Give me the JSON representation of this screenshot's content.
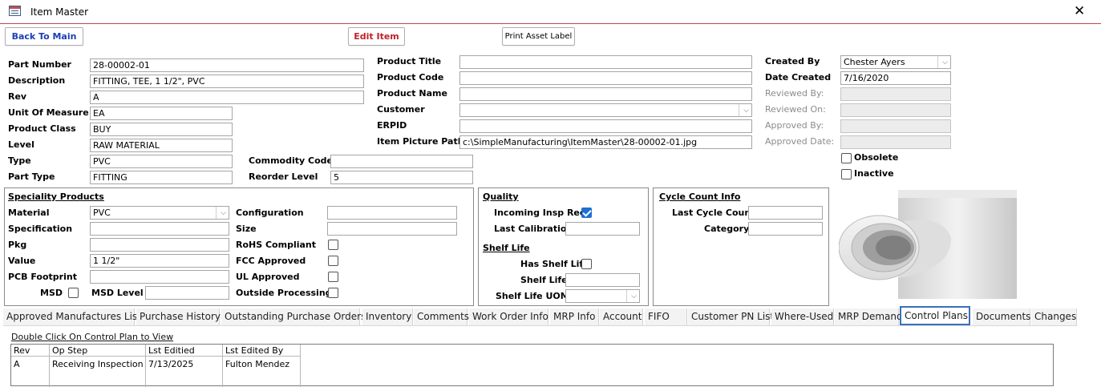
{
  "window": {
    "title": "Item Master",
    "close": "✕"
  },
  "buttons": {
    "back": "Back To Main",
    "edit": "Edit Item",
    "print": "Print Asset Label"
  },
  "item": {
    "part_number_label": "Part Number",
    "part_number": "28-00002-01",
    "description_label": "Description",
    "description": "FITTING, TEE, 1 1/2\", PVC",
    "rev_label": "Rev",
    "rev": "A",
    "uom_label": "Unit Of Measure",
    "uom": "EA",
    "product_class_label": "Product Class",
    "product_class": "BUY",
    "level_label": "Level",
    "level": "RAW MATERIAL",
    "type_label": "Type",
    "type": "PVC",
    "part_type_label": "Part Type",
    "part_type": "FITTING",
    "commodity_code_label": "Commodity Code",
    "commodity_code": "",
    "reorder_level_label": "Reorder Level",
    "reorder_level": "5"
  },
  "product": {
    "title_label": "Product Title",
    "title": "",
    "code_label": "Product Code",
    "code": "",
    "name_label": "Product Name",
    "name": "",
    "customer_label": "Customer",
    "customer": "",
    "erpid_label": "ERPID",
    "erpid": "",
    "picture_path_label": "Item Picture Path",
    "picture_path": "c:\\SimpleManufacturing\\ItemMaster\\28-00002-01.jpg"
  },
  "audit": {
    "created_by_label": "Created By",
    "created_by": "Chester Ayers",
    "date_created_label": "Date Created",
    "date_created": "7/16/2020",
    "reviewed_by_label": "Reviewed By:",
    "reviewed_on_label": "Reviewed On:",
    "approved_by_label": "Approved By:",
    "approved_date_label": "Approved Date:",
    "obsolete_label": "Obsolete",
    "inactive_label": "Inactive"
  },
  "speciality": {
    "title": "Speciality Products",
    "material_label": "Material",
    "material": "PVC",
    "specification_label": "Specification",
    "specification": "",
    "pkg_label": "Pkg",
    "pkg": "",
    "value_label": "Value",
    "value": "1 1/2\"",
    "pcb_label": "PCB Footprint",
    "pcb": "",
    "msd_label": "MSD",
    "msd_level_label": "MSD Level",
    "msd_level": "",
    "configuration_label": "Configuration",
    "configuration": "",
    "size_label": "Size",
    "size": "",
    "rohs_label": "RoHS Compliant",
    "fcc_label": "FCC Approved",
    "ul_label": "UL Approved",
    "outside_label": "Outside Processing"
  },
  "quality": {
    "title": "Quality",
    "incoming_label": "Incoming Insp Reqd",
    "last_cal_label": "Last Calibration",
    "last_cal": "",
    "shelf_title": "Shelf Life",
    "has_shelf_label": "Has Shelf Life",
    "shelf_life_label": "Shelf Life",
    "shelf_life": "",
    "shelf_uom_label": "Shelf Life UOM",
    "shelf_uom": ""
  },
  "cycle": {
    "title": "Cycle Count Info",
    "last_label": "Last Cycle Count",
    "last": "",
    "category_label": "Category",
    "category": ""
  },
  "tabs": [
    "Approved Manufactures List",
    "Purchase History",
    "Outstanding Purchase Orders",
    "Inventory",
    "Comments",
    "Work Order Info",
    "MRP Info",
    "Account",
    "FIFO",
    "Customer PN List",
    "Where-Used",
    "MRP Demand",
    "Control Plans",
    "Documents",
    "Changes"
  ],
  "control_plans": {
    "hint": "Double Click On Control Plan to View",
    "columns": [
      "Rev",
      "Op Step",
      "Lst Editied",
      "Lst Edited By"
    ],
    "rows": [
      [
        "A",
        "Receiving Inspection",
        "7/13/2025",
        "Fulton Mendez"
      ]
    ]
  },
  "icons": {
    "dropdown": "chevron-down-icon",
    "app": "form-icon"
  },
  "colors": {
    "title_rule": "#b94a48",
    "active_tab": "#3a6fbd",
    "back_button": "#1b3fb0",
    "edit_button": "#c0202a",
    "checkbox_on": "#1e6fd0"
  }
}
